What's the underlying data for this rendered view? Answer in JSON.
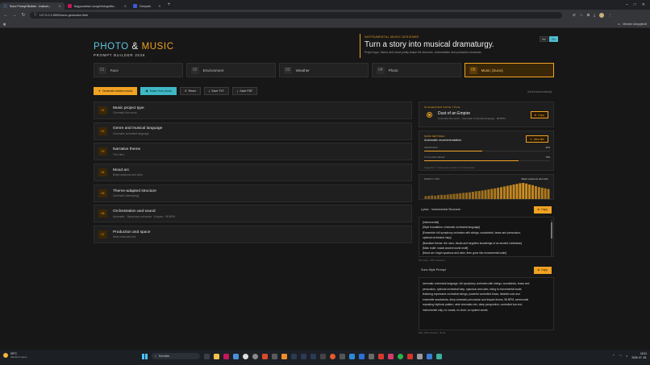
{
  "browser": {
    "tabs": [
      {
        "label": "Suno Prompt Builder - Instrum...",
        "color": "#3b4a5c",
        "active": true
      },
      {
        "label": "Nagyszabású vezgénfotográfia…",
        "color": "#c2185b",
        "active": false
      },
      {
        "label": "Deepsek",
        "color": "#3e5bd6",
        "active": false
      }
    ],
    "url": "127.0.0.1:5500/suno-generator.html",
    "bookmarks_right": "Minden könyvjelző"
  },
  "brand": {
    "title_photo": "PHOTO",
    "title_amp": "&",
    "title_music": "MUSIC",
    "subtitle": "PROMPT BUILDER 2026"
  },
  "hero": {
    "kicker": "INSTRUMENTAL MUSIC DESIGNER",
    "headline": "Turn a story into musical dramaturgy.",
    "description": "Project type, theme and mood jointly shape the structure, orchestration and production character."
  },
  "languages": [
    {
      "code": "HU",
      "active": false
    },
    {
      "code": "EN",
      "active": true
    }
  ],
  "steps": [
    {
      "num": "01",
      "label": "Face",
      "active": false
    },
    {
      "num": "02",
      "label": "Environment",
      "active": false
    },
    {
      "num": "03",
      "label": "Weather",
      "active": false
    },
    {
      "num": "04",
      "label": "Photo",
      "active": false
    },
    {
      "num": "05",
      "label": "Music (Suno)",
      "active": true
    }
  ],
  "actions": {
    "generate": "Generate random music",
    "from_photo": "Music from photo",
    "reset": "Reset",
    "save_txt": "Save TXT",
    "save_pdf": "Save PDF",
    "saved": "Saved automatically"
  },
  "sections": [
    {
      "idx": "01",
      "name": "Music project type",
      "hint": "Cinematic film score"
    },
    {
      "idx": "02",
      "name": "Genre and musical language",
      "hint": "Cinematic orchestral language"
    },
    {
      "idx": "03",
      "name": "Narrative theme",
      "hint": "The ruins"
    },
    {
      "idx": "04",
      "name": "Mood arc",
      "hint": "Begin spacious and calm"
    },
    {
      "idx": "05",
      "name": "Theme-adapted structure",
      "hint": "Cinematic dramaturgy"
    },
    {
      "idx": "06",
      "name": "Orchestration and sound",
      "hint": "Automatic · Symphony orchestra · 6 layers · 98 BPM"
    },
    {
      "idx": "07",
      "name": "Production and space",
      "hint": "Wide cinematic mix"
    }
  ],
  "suggestion": {
    "kicker": "SUGGESTED SONG TITLE",
    "title": "Dust of an Empire",
    "details": "Cinematic film score · Cinematic orchestral language · 98 BPM",
    "copy": "Copy"
  },
  "settings": {
    "kicker": "SUNO SETTINGS",
    "mode": "Automatic recommendation",
    "new_title": "New title",
    "weirdness_label": "WEIRDNESS",
    "weirdness_pct": "46%",
    "weirdness": 0.46,
    "influence_label": "STYLE INFLUENCE",
    "influence_pct": "75%",
    "influence": 0.75,
    "note": "Suggestion: in Suno, leave ‘Custom’ on for this prompt"
  },
  "arc": {
    "label": "ENERGY ARC",
    "right_label": "Begin spacious and calm",
    "levels": [
      0.18,
      0.2,
      0.22,
      0.2,
      0.24,
      0.26,
      0.25,
      0.28,
      0.3,
      0.32,
      0.34,
      0.36,
      0.38,
      0.4,
      0.42,
      0.45,
      0.48,
      0.5,
      0.53,
      0.56,
      0.6,
      0.63,
      0.66,
      0.7,
      0.74,
      0.78,
      0.82,
      0.86,
      0.9,
      0.94,
      0.98,
      1.0,
      0.96,
      0.9,
      0.86,
      0.8,
      0.74,
      0.7,
      0.66,
      0.62
    ],
    "color": "#d1901f"
  },
  "lyrics": {
    "label": "Lyrics · Instrumental Structure",
    "copy": "Copy",
    "lines": [
      "[Instrumental]",
      "[Style foundation: cinematic orchestral language]",
      "[Ensemble: full symphony orchestra with strings, woodwinds, brass and percussion,",
      "optional orchestral harp]",
      "[Narrative theme: the ruins, rituals and forgotten knowledge of an ancient civilization]",
      "[Main motif: modal ancient world motif]",
      "[Mood arc: begin spacious and calm, then grow into monumental scale]"
    ],
    "meta": "521 words · 3487 characters"
  },
  "style": {
    "label": "Suno Style Prompt",
    "copy": "Copy",
    "lines": [
      "cinematic orchestral language, full symphony orchestra with strings, woodwinds, brass and",
      "percussion, optional orchestral harp, spacious and calm, rising to monumental scale,",
      "featuring expressive orchestral strings, powerful controlled brass, detailed solo and",
      "ensemble woodwinds, deep cinematic percussion and impact drums, 98 BPM, ceremonial",
      "repeating rhythmic pattern, wide cinematic mix, deep perspective, controlled low end,",
      "instrumental only, no vocals, no choir, no spoken words"
    ],
    "meta": "998 / 1000 character · 38 tab"
  },
  "taskbar": {
    "temp": "29°C",
    "weather": "Időnként napos",
    "search": "Keresés",
    "time": "18:31",
    "date": "2026. 07. 28."
  }
}
